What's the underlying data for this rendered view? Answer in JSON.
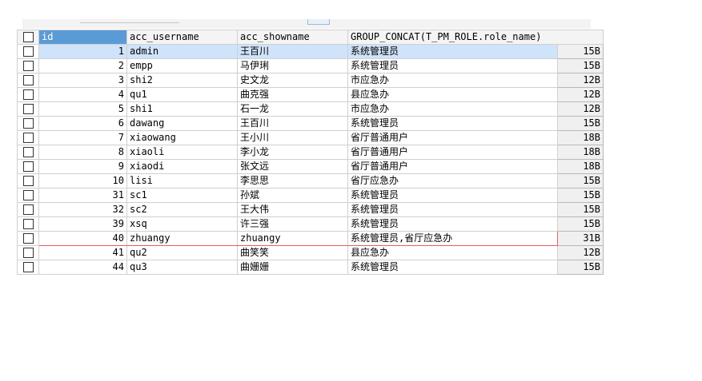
{
  "grid": {
    "columns": [
      "id",
      "acc_username",
      "acc_showname",
      "GROUP_CONCAT(T_PM_ROLE.role_name)",
      ""
    ],
    "rows": [
      {
        "id": "1",
        "username": "admin",
        "showname": "王百川",
        "roles": "系统管理员",
        "len": "15B"
      },
      {
        "id": "2",
        "username": "empp",
        "showname": "马伊琍",
        "roles": "系统管理员",
        "len": "15B"
      },
      {
        "id": "3",
        "username": "shi2",
        "showname": "史文龙",
        "roles": "市应急办",
        "len": "12B"
      },
      {
        "id": "4",
        "username": "qu1",
        "showname": "曲克强",
        "roles": "县应急办",
        "len": "12B"
      },
      {
        "id": "5",
        "username": "shi1",
        "showname": "石一龙",
        "roles": "市应急办",
        "len": "12B"
      },
      {
        "id": "6",
        "username": "dawang",
        "showname": "王百川",
        "roles": "系统管理员",
        "len": "15B"
      },
      {
        "id": "7",
        "username": "xiaowang",
        "showname": "王小川",
        "roles": "省厅普通用户",
        "len": "18B"
      },
      {
        "id": "8",
        "username": "xiaoli",
        "showname": "李小龙",
        "roles": "省厅普通用户",
        "len": "18B"
      },
      {
        "id": "9",
        "username": "xiaodi",
        "showname": "张文远",
        "roles": "省厅普通用户",
        "len": "18B"
      },
      {
        "id": "10",
        "username": "lisi",
        "showname": "李思思",
        "roles": "省厅应急办",
        "len": "15B"
      },
      {
        "id": "31",
        "username": "sc1",
        "showname": "孙斌",
        "roles": "系统管理员",
        "len": "15B"
      },
      {
        "id": "32",
        "username": "sc2",
        "showname": "王大伟",
        "roles": "系统管理员",
        "len": "15B"
      },
      {
        "id": "39",
        "username": "xsq",
        "showname": "许三强",
        "roles": "系统管理员",
        "len": "15B"
      },
      {
        "id": "40",
        "username": "zhuangy",
        "showname": "zhuangy",
        "roles": "系统管理员,省厅应急办",
        "len": "31B"
      },
      {
        "id": "41",
        "username": "qu2",
        "showname": "曲笑笑",
        "roles": "县应急办",
        "len": "12B"
      },
      {
        "id": "44",
        "username": "qu3",
        "showname": "曲姗姗",
        "roles": "系统管理员",
        "len": "15B"
      }
    ]
  }
}
